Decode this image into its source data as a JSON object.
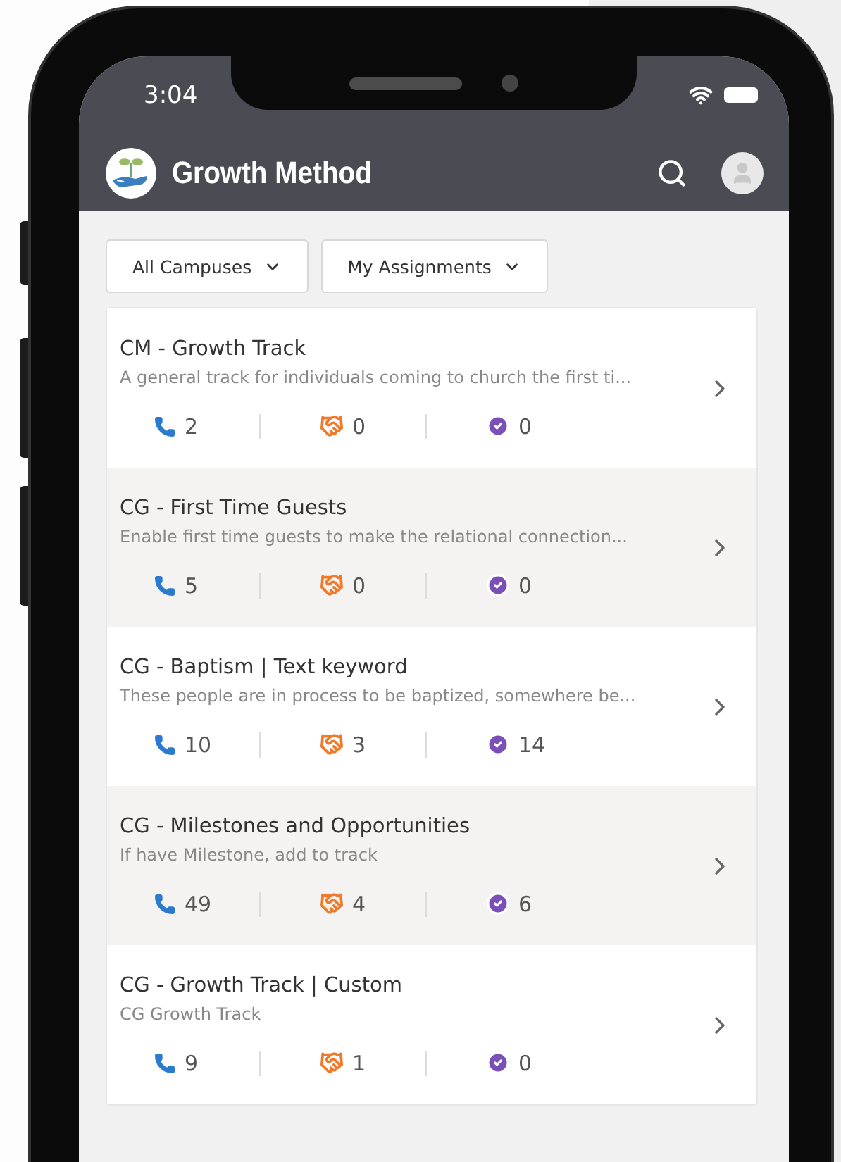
{
  "status_bar": {
    "time": "3:04"
  },
  "app_bar": {
    "title": "Growth Method"
  },
  "filters": [
    {
      "label": "All Campuses"
    },
    {
      "label": "My Assignments"
    }
  ],
  "tracks": [
    {
      "title": "CM - Growth Track",
      "description": "A general track for individuals coming to church the first ti...",
      "calls": "2",
      "connections": "0",
      "completed": "0"
    },
    {
      "title": "CG - First Time Guests",
      "description": "Enable first time guests to make the relational connection...",
      "calls": "5",
      "connections": "0",
      "completed": "0"
    },
    {
      "title": "CG - Baptism | Text keyword",
      "description": "These people are in process to be baptized, somewhere be...",
      "calls": "10",
      "connections": "3",
      "completed": "14"
    },
    {
      "title": "CG - Milestones and Opportunities",
      "description": "If have Milestone, add to track",
      "calls": "49",
      "connections": "4",
      "completed": "6"
    },
    {
      "title": "CG - Growth Track | Custom",
      "description": "CG Growth Track",
      "calls": "9",
      "connections": "1",
      "completed": "0"
    }
  ]
}
